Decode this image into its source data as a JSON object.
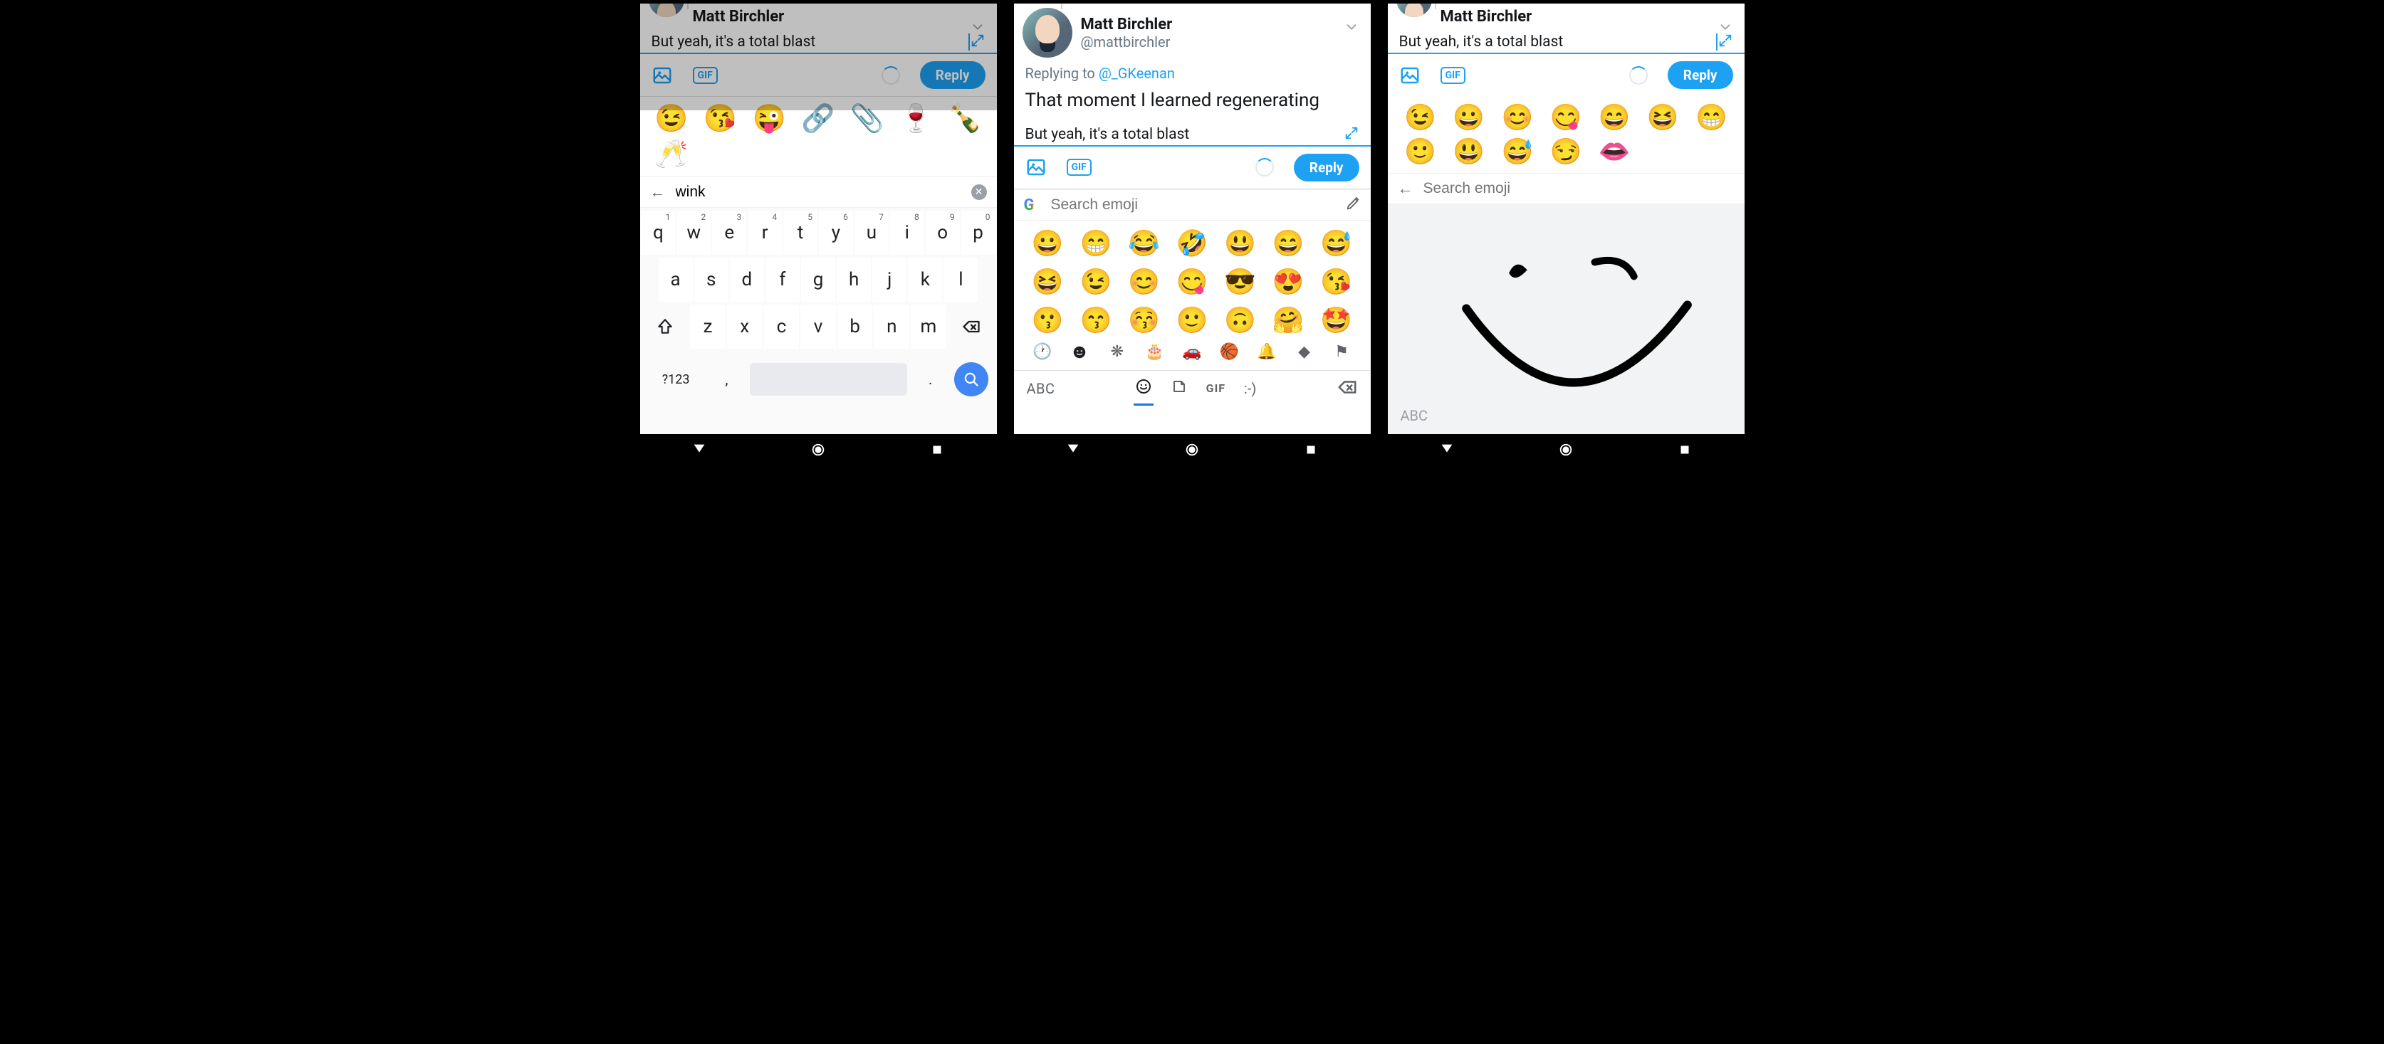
{
  "user": {
    "name": "Matt Birchler",
    "handle": "@mattbirchler"
  },
  "reply_to": {
    "prefix": "Replying to ",
    "mention": "@_GKeenan"
  },
  "tweet_body": "That moment I learned regenerating",
  "compose_value": "But yeah, it's a total blast",
  "reply_button": "Reply",
  "gif_label": "GIF",
  "panel1": {
    "search_value": "wink",
    "emojis": [
      "😉",
      "😘",
      "😜",
      "🔗",
      "📎",
      "🍷",
      "🍾",
      "🥂"
    ],
    "keyboard": {
      "row1": [
        "q",
        "w",
        "e",
        "r",
        "t",
        "y",
        "u",
        "i",
        "o",
        "p"
      ],
      "row1_sup": [
        "1",
        "2",
        "3",
        "4",
        "5",
        "6",
        "7",
        "8",
        "9",
        "0"
      ],
      "row2": [
        "a",
        "s",
        "d",
        "f",
        "g",
        "h",
        "j",
        "k",
        "l"
      ],
      "row3": [
        "z",
        "x",
        "c",
        "v",
        "b",
        "n",
        "m"
      ],
      "sym_key": "?123",
      "comma": ",",
      "period": "."
    }
  },
  "panel2": {
    "search_placeholder": "Search emoji",
    "grid": [
      [
        "😀",
        "😁",
        "😂",
        "🤣",
        "😃",
        "😄",
        "😅"
      ],
      [
        "😆",
        "😉",
        "😊",
        "😋",
        "😎",
        "😍",
        "😘"
      ],
      [
        "😗",
        "😙",
        "😚",
        "🙂",
        "🙃",
        "🤗",
        "🤩"
      ]
    ],
    "abc": "ABC",
    "gif_mode": "GIF",
    "text_face": ":-)"
  },
  "panel3": {
    "search_placeholder": "Search emoji",
    "emojis_top": [
      "😉",
      "😀",
      "😊",
      "😋",
      "😄",
      "😆",
      "😁"
    ],
    "emojis_bot": [
      "🙂",
      "😃",
      "😅",
      "😏",
      "👄"
    ],
    "abc": "ABC"
  }
}
